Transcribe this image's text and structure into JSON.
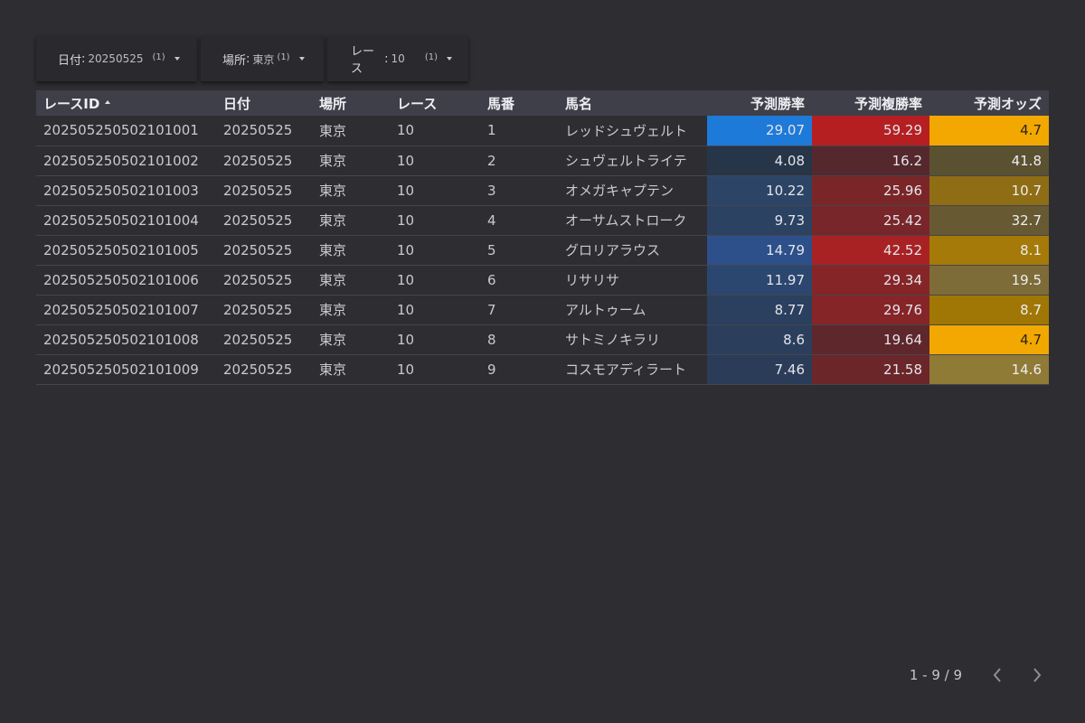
{
  "filters": [
    {
      "name": "日付",
      "value": "20250525",
      "count": "(1)"
    },
    {
      "name": "場所",
      "value": "東京",
      "count": "(1)"
    },
    {
      "name": "レース",
      "value": "10",
      "count": "(1)"
    }
  ],
  "table": {
    "columns": [
      "レースID",
      "日付",
      "場所",
      "レース",
      "馬番",
      "馬名",
      "予測勝率",
      "予測複勝率",
      "予測オッズ"
    ],
    "sort_column": "レースID",
    "sort_direction": "ascending",
    "rows": [
      [
        "202505250502101001",
        "20250525",
        "東京",
        "10",
        "1",
        "レッドシュヴェルト",
        "29.07",
        "59.29",
        "4.7"
      ],
      [
        "202505250502101002",
        "20250525",
        "東京",
        "10",
        "2",
        "シュヴェルトライテ",
        "4.08",
        "16.2",
        "41.8"
      ],
      [
        "202505250502101003",
        "20250525",
        "東京",
        "10",
        "3",
        "オメガキャプテン",
        "10.22",
        "25.96",
        "10.7"
      ],
      [
        "202505250502101004",
        "20250525",
        "東京",
        "10",
        "4",
        "オーサムストローク",
        "9.73",
        "25.42",
        "32.7"
      ],
      [
        "202505250502101005",
        "20250525",
        "東京",
        "10",
        "5",
        "グロリアラウス",
        "14.79",
        "42.52",
        "8.1"
      ],
      [
        "202505250502101006",
        "20250525",
        "東京",
        "10",
        "6",
        "リサリサ",
        "11.97",
        "29.34",
        "19.5"
      ],
      [
        "202505250502101007",
        "20250525",
        "東京",
        "10",
        "7",
        "アルトゥーム",
        "8.77",
        "29.76",
        "8.7"
      ],
      [
        "202505250502101008",
        "20250525",
        "東京",
        "10",
        "8",
        "サトミノキラリ",
        "8.6",
        "19.64",
        "4.7"
      ],
      [
        "202505250502101009",
        "20250525",
        "東京",
        "10",
        "9",
        "コスモアディラート",
        "7.46",
        "21.58",
        "14.6"
      ]
    ],
    "heatmap_colors": {
      "win_rate": [
        "#1e7ad8",
        "#263548",
        "#2c4466",
        "#2b4262",
        "#2d508a",
        "#2c476f",
        "#2b3f5e",
        "#2b3f5d",
        "#2b3c58"
      ],
      "place_rate": [
        "#b51f22",
        "#55282e",
        "#7a2527",
        "#78262a",
        "#a82224",
        "#852527",
        "#852528",
        "#5e272b",
        "#6b262a"
      ],
      "odds": [
        "#f2a800",
        "#5a5131",
        "#8f6d14",
        "#675a33",
        "#a57a08",
        "#7d6c38",
        "#a07605",
        "#f2a800",
        "#8f7a36"
      ]
    }
  },
  "pagination": {
    "range": "1 - 9 / 9"
  }
}
